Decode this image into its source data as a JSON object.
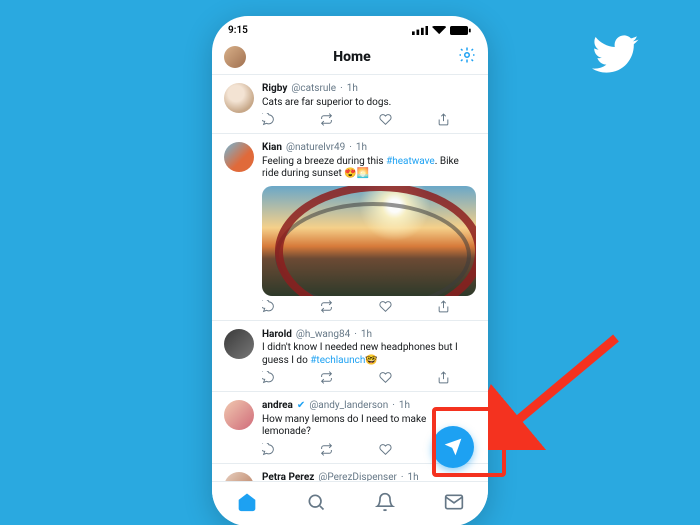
{
  "statusbar": {
    "time": "9:15"
  },
  "header": {
    "title": "Home"
  },
  "tweets": [
    {
      "name": "Rigby",
      "handle": "@catsrule",
      "time": "1h",
      "text": "Cats are far superior to dogs."
    },
    {
      "name": "Kian",
      "handle": "@naturelvr49",
      "time": "1h",
      "text_pre": "Feeling a breeze during this ",
      "hashtag": "#heatwave",
      "text_post": ". Bike ride during sunset ",
      "emoji": "😍🌅",
      "has_media": true
    },
    {
      "name": "Harold",
      "handle": "@h_wang84",
      "time": "1h",
      "text_pre": "I didn't know I needed new headphones but I guess I do ",
      "hashtag": "#techlaunch",
      "emoji": "🤓"
    },
    {
      "name": "andrea",
      "verified": true,
      "handle": "@andy_landerson",
      "time": "1h",
      "text": "How many lemons do I need to make lemonade?"
    },
    {
      "name": "Petra Perez",
      "handle": "@PerezDispenser",
      "time": "1h"
    }
  ],
  "action_icons": {
    "reply": "reply-icon",
    "retweet": "retweet-icon",
    "like": "like-icon",
    "share": "share-icon"
  },
  "nav": {
    "home": "home-icon",
    "search": "search-icon",
    "notifications": "bell-icon",
    "messages": "mail-icon"
  }
}
